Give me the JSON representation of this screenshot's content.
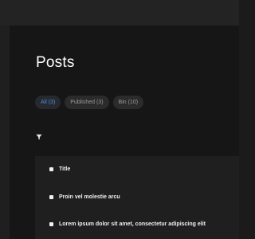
{
  "page": {
    "title": "Posts"
  },
  "tabs": [
    {
      "label": "All (3)",
      "active": true
    },
    {
      "label": "Published (3)",
      "active": false
    },
    {
      "label": "Bin (10)",
      "active": false
    }
  ],
  "toolbar": {
    "filter_icon": "filter-icon"
  },
  "table": {
    "header": {
      "title_label": "Title"
    },
    "rows": [
      {
        "title": "Proin vel molestie arcu"
      },
      {
        "title": "Lorem ipsum dolor sit amet, consectetur adipiscing elit"
      }
    ]
  },
  "colors": {
    "background": "#161616",
    "accent": "#4b8ee0",
    "pill": "#2b2b2b"
  }
}
